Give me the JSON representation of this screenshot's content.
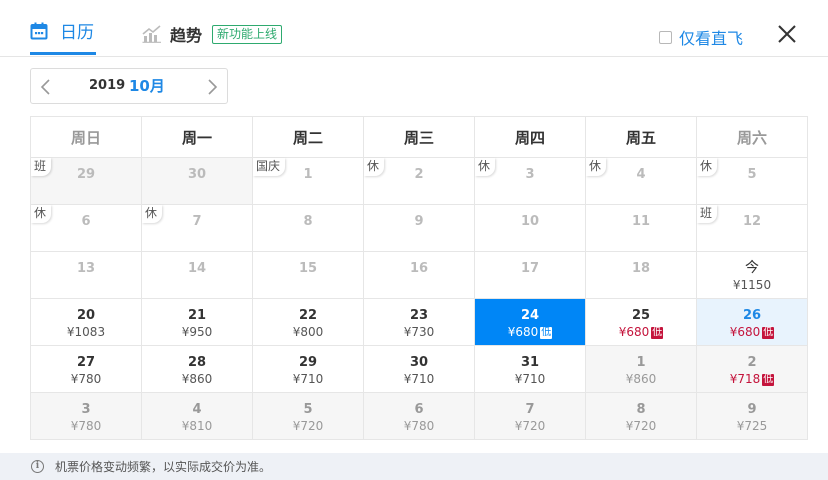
{
  "tabs": {
    "calendar_label": "日历",
    "trend_label": "趋势",
    "trend_badge": "新功能上线"
  },
  "direct_only_label": "仅看直飞",
  "picker": {
    "year": "2019",
    "month": "10月"
  },
  "weekdays": [
    "周日",
    "周一",
    "周二",
    "周三",
    "周四",
    "周五",
    "周六"
  ],
  "weeks": [
    [
      {
        "day": "29",
        "price": "",
        "tag": "班",
        "state": "gray"
      },
      {
        "day": "30",
        "price": "",
        "tag": "",
        "state": "gray"
      },
      {
        "day": "1",
        "price": "",
        "tag": "国庆",
        "state": "past"
      },
      {
        "day": "2",
        "price": "",
        "tag": "休",
        "state": "past"
      },
      {
        "day": "3",
        "price": "",
        "tag": "休",
        "state": "past"
      },
      {
        "day": "4",
        "price": "",
        "tag": "休",
        "state": "past"
      },
      {
        "day": "5",
        "price": "",
        "tag": "休",
        "state": "past"
      }
    ],
    [
      {
        "day": "6",
        "price": "",
        "tag": "休",
        "state": "past"
      },
      {
        "day": "7",
        "price": "",
        "tag": "休",
        "state": "past"
      },
      {
        "day": "8",
        "price": "",
        "tag": "",
        "state": "past"
      },
      {
        "day": "9",
        "price": "",
        "tag": "",
        "state": "past"
      },
      {
        "day": "10",
        "price": "",
        "tag": "",
        "state": "past"
      },
      {
        "day": "11",
        "price": "",
        "tag": "",
        "state": "past"
      },
      {
        "day": "12",
        "price": "",
        "tag": "班",
        "state": "past"
      }
    ],
    [
      {
        "day": "13",
        "price": "",
        "tag": "",
        "state": "past"
      },
      {
        "day": "14",
        "price": "",
        "tag": "",
        "state": "past"
      },
      {
        "day": "15",
        "price": "",
        "tag": "",
        "state": "past"
      },
      {
        "day": "16",
        "price": "",
        "tag": "",
        "state": "past"
      },
      {
        "day": "17",
        "price": "",
        "tag": "",
        "state": "past"
      },
      {
        "day": "18",
        "price": "",
        "tag": "",
        "state": "past"
      },
      {
        "day": "今",
        "price": "¥1150",
        "tag": "",
        "state": "today"
      }
    ],
    [
      {
        "day": "20",
        "price": "¥1083",
        "tag": "",
        "state": "normal"
      },
      {
        "day": "21",
        "price": "¥950",
        "tag": "",
        "state": "normal"
      },
      {
        "day": "22",
        "price": "¥800",
        "tag": "",
        "state": "normal"
      },
      {
        "day": "23",
        "price": "¥730",
        "tag": "",
        "state": "normal"
      },
      {
        "day": "24",
        "price": "¥680",
        "low": "低",
        "tag": "",
        "state": "selected"
      },
      {
        "day": "25",
        "price": "¥680",
        "low": "低",
        "tag": "",
        "state": "normal-red"
      },
      {
        "day": "26",
        "price": "¥680",
        "low": "低",
        "tag": "",
        "state": "highlight"
      }
    ],
    [
      {
        "day": "27",
        "price": "¥780",
        "tag": "",
        "state": "normal"
      },
      {
        "day": "28",
        "price": "¥860",
        "tag": "",
        "state": "normal"
      },
      {
        "day": "29",
        "price": "¥710",
        "tag": "",
        "state": "normal"
      },
      {
        "day": "30",
        "price": "¥710",
        "tag": "",
        "state": "normal"
      },
      {
        "day": "31",
        "price": "¥710",
        "tag": "",
        "state": "normal"
      },
      {
        "day": "1",
        "price": "¥860",
        "tag": "",
        "state": "next"
      },
      {
        "day": "2",
        "price": "¥718",
        "low": "低",
        "tag": "",
        "state": "next-red"
      }
    ],
    [
      {
        "day": "3",
        "price": "¥780",
        "tag": "",
        "state": "next"
      },
      {
        "day": "4",
        "price": "¥810",
        "tag": "",
        "state": "next"
      },
      {
        "day": "5",
        "price": "¥720",
        "tag": "",
        "state": "next"
      },
      {
        "day": "6",
        "price": "¥780",
        "tag": "",
        "state": "next"
      },
      {
        "day": "7",
        "price": "¥720",
        "tag": "",
        "state": "next"
      },
      {
        "day": "8",
        "price": "¥720",
        "tag": "",
        "state": "next"
      },
      {
        "day": "9",
        "price": "¥725",
        "tag": "",
        "state": "next"
      }
    ]
  ],
  "footer": {
    "note": "机票价格变动频繁，以实际成交价为准。",
    "info_symbol": "i"
  },
  "colors": {
    "accent": "#1e88e5",
    "selected": "#0086f6",
    "low_price": "#c4143c",
    "badge": "#2eaa6f"
  }
}
